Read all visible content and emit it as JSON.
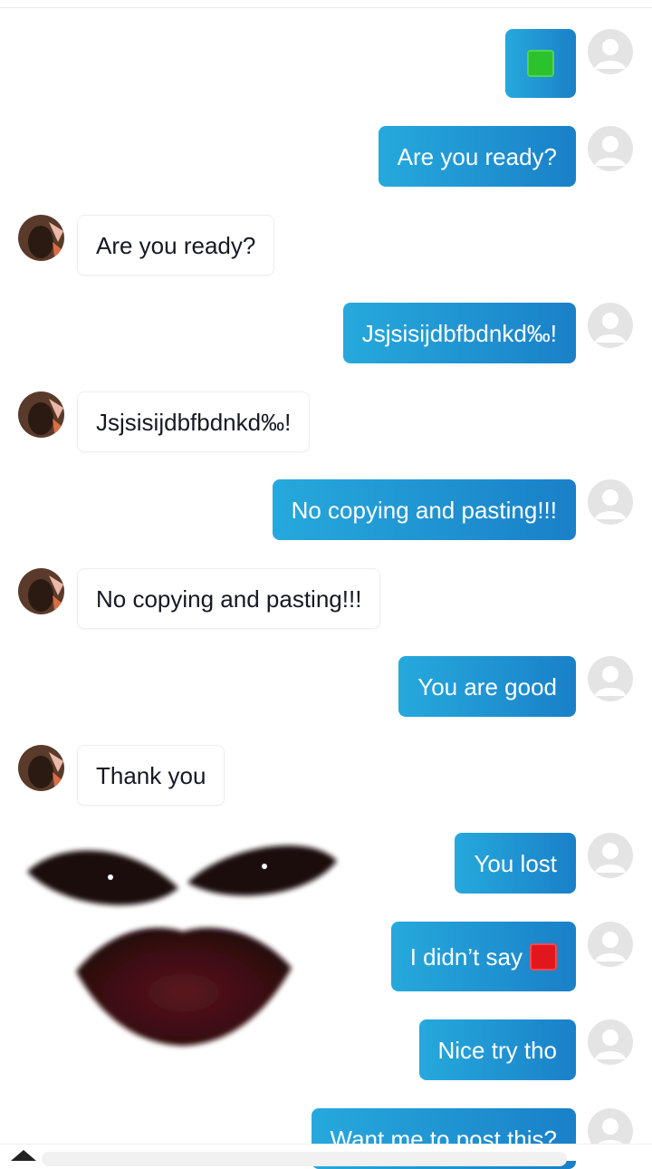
{
  "colors": {
    "sent_bubble_start": "#26a9dc",
    "sent_bubble_end": "#1a80c8",
    "received_bubble": "#ffffff",
    "green_square_emoji": "#2ec12e",
    "red_square_emoji": "#e0181e"
  },
  "messages": [
    {
      "from": "me",
      "emoji": "green-square-icon"
    },
    {
      "from": "me",
      "text": "Are you ready?"
    },
    {
      "from": "them",
      "text": "Are you ready?"
    },
    {
      "from": "me",
      "text": "Jsjsisijdbfbdnkd‰!"
    },
    {
      "from": "them",
      "text": "Jsjsisijdbfbdnkd‰!"
    },
    {
      "from": "me",
      "text": "No copying and pasting!!!"
    },
    {
      "from": "them",
      "text": "No copying and pasting!!!"
    },
    {
      "from": "me",
      "text": "You are good"
    },
    {
      "from": "them",
      "text": "Thank you"
    },
    {
      "from": "me",
      "text": "You lost"
    },
    {
      "from": "me",
      "text": "I didn’t say",
      "emoji": "red-square-icon"
    },
    {
      "from": "me",
      "text": "Nice try tho"
    },
    {
      "from": "me",
      "text": "Want me to post this?"
    }
  ],
  "overlay": {
    "sticker": "face-sticker"
  },
  "composer": {
    "icon": "emoji-keyboard-icon"
  }
}
